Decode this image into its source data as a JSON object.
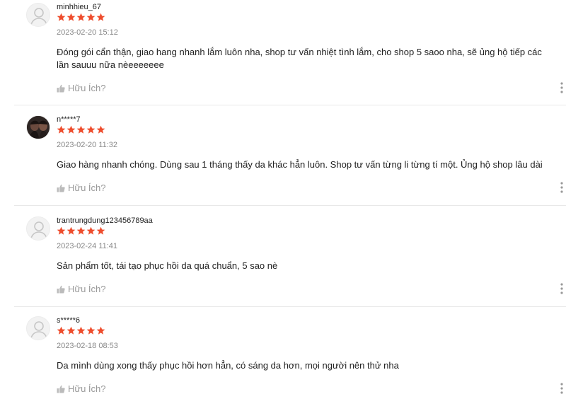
{
  "colors": {
    "star": "#ee4d2d",
    "muted": "#999999",
    "divider": "#e8e8e8"
  },
  "helpful_label": "Hữu Ích?",
  "reviews": [
    {
      "username": "minhhieu_67",
      "rating": 5,
      "timestamp": "2023-02-20 15:12",
      "content": "Đóng gói cẩn thận, giao hang nhanh lắm luôn nha, shop tư vấn nhiệt tình lắm,  cho shop 5 saoo nha, sẽ ủng hộ tiếp các lần sauuu nữa nèeeeeeee",
      "avatar": "default-avatar-icon"
    },
    {
      "username": "n*****7",
      "rating": 5,
      "timestamp": "2023-02-20 11:32",
      "content": "Giao hàng nhanh chóng. Dùng sau 1 tháng thấy da khác hẳn luôn. Shop tư vấn từng li từng tí một. Ủng hộ shop lâu dài",
      "avatar": "user-photo"
    },
    {
      "username": "trantrungdung123456789aa",
      "rating": 5,
      "timestamp": "2023-02-24 11:41",
      "content": "Sản phẩm tốt, tái tạo phục hồi da quá chuẩn, 5 sao nè",
      "avatar": "default-avatar-icon"
    },
    {
      "username": "s*****6",
      "rating": 5,
      "timestamp": "2023-02-18 08:53",
      "content": "Da mình dùng xong thấy phục hồi hơn hẳn, có sáng da hơn, mọi người nên thử nha",
      "avatar": "default-avatar-icon"
    }
  ]
}
